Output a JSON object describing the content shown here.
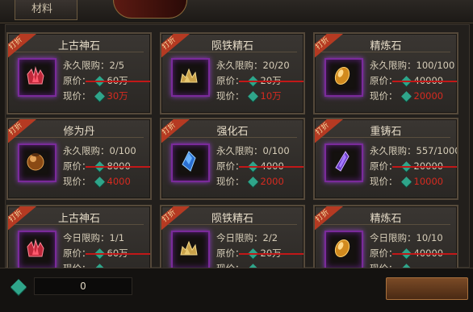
{
  "window": {
    "title": "材料"
  },
  "labels": {
    "original_price": "原价：",
    "current_price": "现价："
  },
  "colors": {
    "accent_red": "#d62a20",
    "gem_green": "#2fa58a",
    "frame_purple": "#7a2a9a"
  },
  "cards": [
    {
      "ribbon": "打折",
      "name": "上古神石",
      "icon": "red-crystal-icon",
      "limit": "永久限购：2/5",
      "orig": "60万",
      "now": "30万"
    },
    {
      "ribbon": "打折",
      "name": "陨铁精石",
      "icon": "gold-ore-icon",
      "limit": "永久限购：20/20",
      "orig": "20万",
      "now": "10万"
    },
    {
      "ribbon": "打折",
      "name": "精炼石",
      "icon": "amber-stone-icon",
      "limit": "永久限购：100/100",
      "orig": "40000",
      "now": "20000"
    },
    {
      "ribbon": "打折",
      "name": "修为丹",
      "icon": "orb-icon",
      "limit": "永久限购：0/100",
      "orig": "8000",
      "now": "4000"
    },
    {
      "ribbon": "打折",
      "name": "强化石",
      "icon": "blue-crystal-icon",
      "limit": "永久限购：0/100",
      "orig": "4000",
      "now": "2000"
    },
    {
      "ribbon": "打折",
      "name": "重铸石",
      "icon": "purple-crystal-icon",
      "limit": "永久限购：557/1000",
      "orig": "20000",
      "now": "10000"
    },
    {
      "ribbon": "打折",
      "name": "上古神石",
      "icon": "red-crystal-icon",
      "limit": "今日限购：1/1",
      "orig": "60万",
      "now": ""
    },
    {
      "ribbon": "打折",
      "name": "陨铁精石",
      "icon": "gold-ore-icon",
      "limit": "今日限购：2/2",
      "orig": "20万",
      "now": ""
    },
    {
      "ribbon": "打折",
      "name": "精炼石",
      "icon": "amber-stone-icon",
      "limit": "今日限购：10/10",
      "orig": "40000",
      "now": ""
    }
  ],
  "wallet": {
    "icon": "green-gem-icon",
    "amount": "0"
  }
}
